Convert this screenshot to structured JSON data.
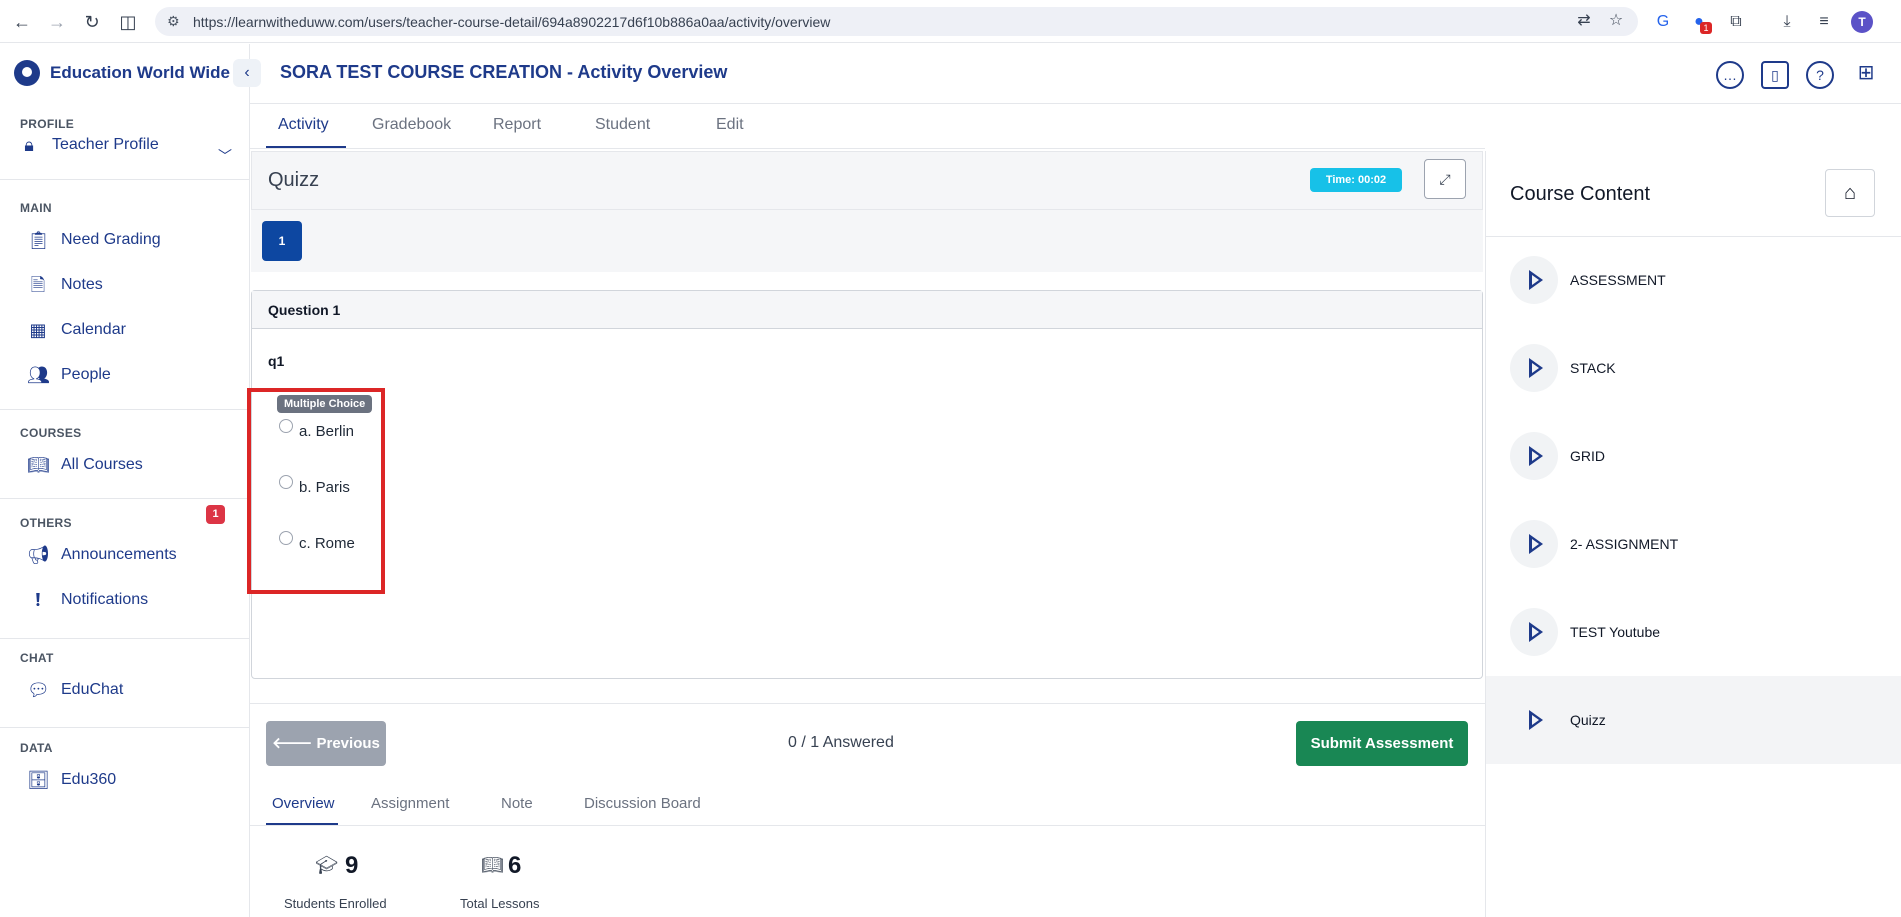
{
  "browser": {
    "url": "https://learnwitheduww.com/users/teacher-course-detail/694a8902217d6f10b886a0aa/activity/overview",
    "extension_badge": "1",
    "profile_initial": "T"
  },
  "sidebar": {
    "brand": "Education World Wide",
    "sections": {
      "profile": "PROFILE",
      "main": "MAIN",
      "courses": "COURSES",
      "others": "OTHERS",
      "chat": "CHAT",
      "data": "DATA"
    },
    "items": {
      "teacher_profile": "Teacher Profile",
      "need_grading": "Need Grading",
      "notes": "Notes",
      "calendar": "Calendar",
      "people": "People",
      "all_courses": "All Courses",
      "announcements": "Announcements",
      "announcements_badge": "1",
      "notifications": "Notifications",
      "educhat": "EduChat",
      "edu360": "Edu360"
    }
  },
  "header": {
    "title": "SORA TEST COURSE CREATION - Activity Overview"
  },
  "tabs": [
    "Activity",
    "Gradebook",
    "Report",
    "Student",
    "Edit"
  ],
  "quiz": {
    "title": "Quizz",
    "timer": "Time: 00:02",
    "question_nav": [
      "1"
    ],
    "question_heading": "Question 1",
    "question_text": "q1",
    "type_badge": "Multiple Choice",
    "options": [
      "a. Berlin",
      "b. Paris",
      "c. Rome"
    ],
    "prev_label": "🡐 Previous",
    "answered": "0 / 1 Answered",
    "submit_label": "Submit Assessment"
  },
  "bottom_tabs": [
    "Overview",
    "Assignment",
    "Note",
    "Discussion Board"
  ],
  "stats": {
    "students_value": "9",
    "students_label": "Students Enrolled",
    "lessons_value": "6",
    "lessons_label": "Total Lessons"
  },
  "course_content": {
    "title": "Course Content",
    "lessons": [
      "ASSESSMENT",
      "STACK",
      "GRID",
      "2- ASSIGNMENT",
      "TEST Youtube",
      "Quizz"
    ]
  },
  "colors": {
    "brand": "#1e3a8a",
    "timer": "#17c1e8",
    "submit": "#198754",
    "highlight": "#dc2626"
  }
}
